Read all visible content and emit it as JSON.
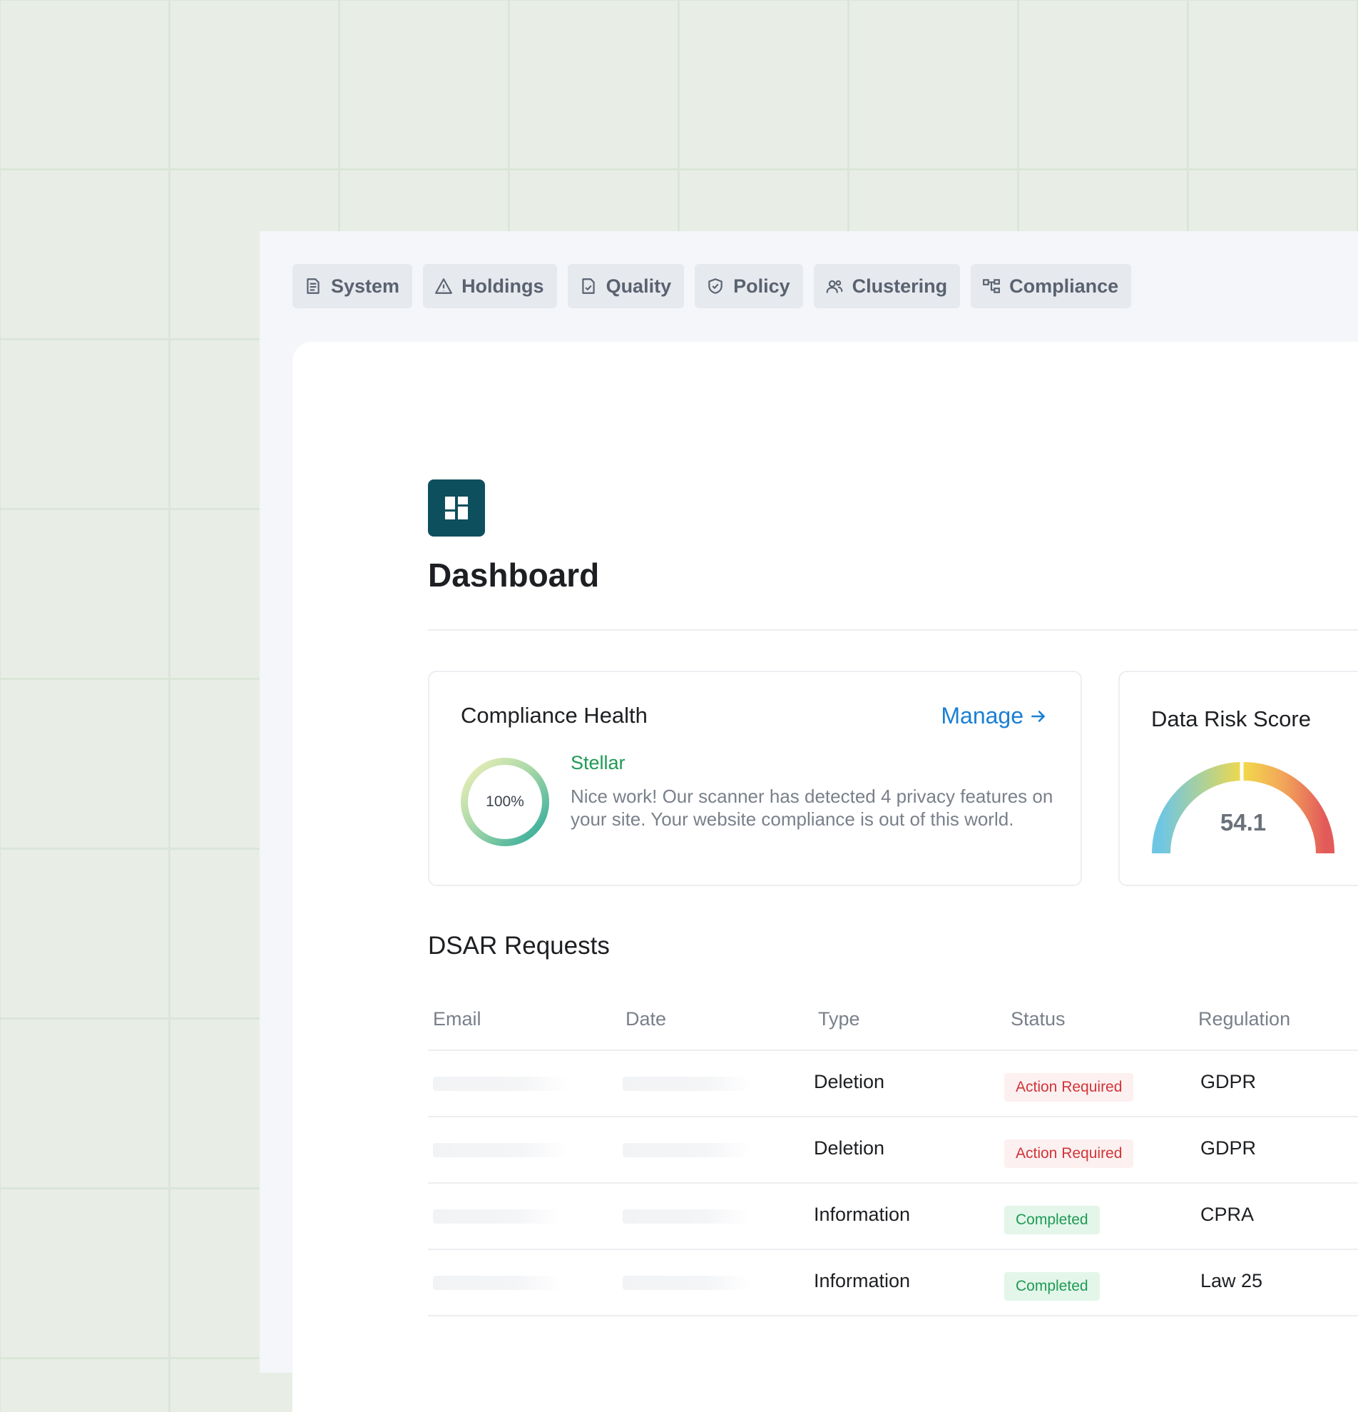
{
  "tabs": [
    {
      "label": "System",
      "icon": "document-icon"
    },
    {
      "label": "Holdings",
      "icon": "warning-icon"
    },
    {
      "label": "Quality",
      "icon": "file-check-icon"
    },
    {
      "label": "Policy",
      "icon": "shield-icon"
    },
    {
      "label": "Clustering",
      "icon": "users-icon"
    },
    {
      "label": "Compliance",
      "icon": "hierarchy-icon"
    }
  ],
  "page": {
    "title": "Dashboard",
    "icon": "dashboard-icon"
  },
  "compliance_health": {
    "title": "Compliance Health",
    "manage_label": "Manage",
    "percent_label": "100%",
    "percent_value": 100,
    "rating": "Stellar",
    "description": "Nice work! Our scanner has detected 4 privacy features on your site. Your website compliance is out of this world."
  },
  "data_risk": {
    "title": "Data Risk Score",
    "score": "54.1"
  },
  "dsar": {
    "title": "DSAR Requests",
    "columns": [
      "Email",
      "Date",
      "Type",
      "Status",
      "Regulation"
    ],
    "rows": [
      {
        "type": "Deletion",
        "status": "Action Required",
        "regulation": "GDPR"
      },
      {
        "type": "Deletion",
        "status": "Action Required",
        "regulation": "GDPR"
      },
      {
        "type": "Information",
        "status": "Completed",
        "regulation": "CPRA"
      },
      {
        "type": "Information",
        "status": "Completed",
        "regulation": "Law 25"
      }
    ]
  },
  "colors": {
    "accent": "#1a7fd4",
    "brand": "#0e4f5e",
    "success": "#1f9a55",
    "danger": "#d13438",
    "background_grid": "#e8eee6"
  }
}
